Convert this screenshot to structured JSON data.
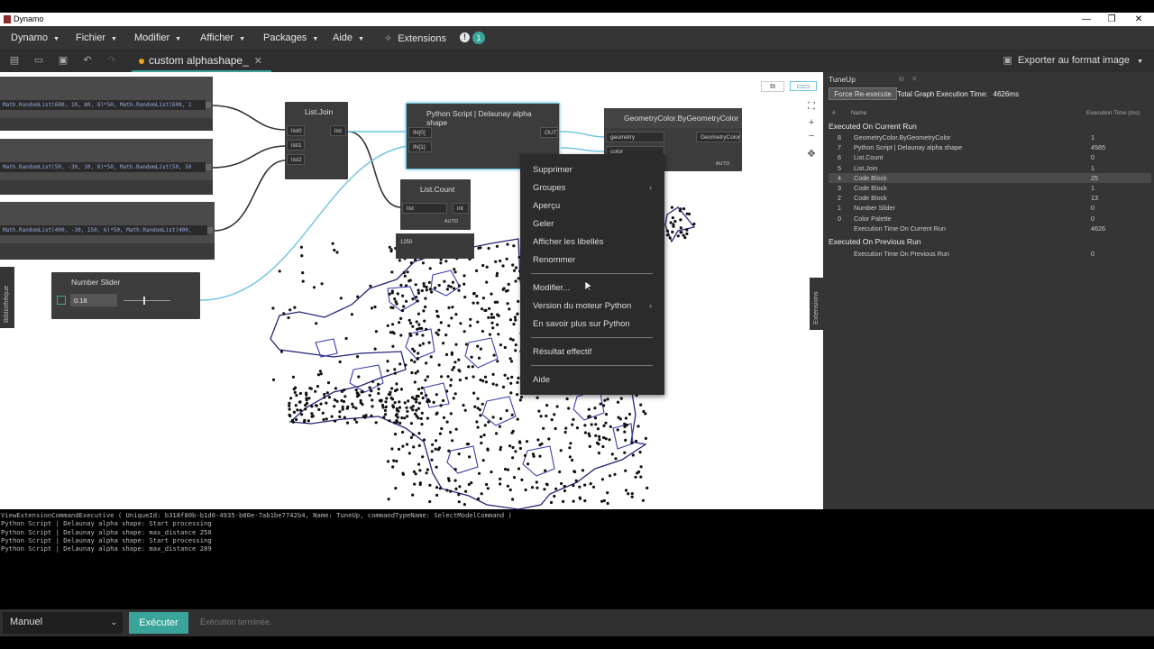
{
  "window": {
    "title": "Dynamo",
    "minimize": "—",
    "maximize": "❐",
    "close": "✕"
  },
  "menu": {
    "items": [
      "Dynamo",
      "Fichier",
      "Modifier",
      "Afficher",
      "Packages",
      "Aide"
    ],
    "extensions": "Extensions",
    "notification_count": "1",
    "alert": "!"
  },
  "toolbar": {
    "tab_title": "custom alphashape_",
    "tab_close": "✕",
    "export_label": "Exporter au format image"
  },
  "nodes": {
    "code_blocks": [
      "Math.RandomList(600, 10, 80, 8)*50, Math.RandomList(600, 1",
      "Math.RandomList(50, -30, 10, 8)*50, Math.RandomList(50, 50",
      "Math.RandomList(400, -30, 150, 6)*50, Math.RandomList(400,"
    ],
    "list_join": {
      "title": "List.Join",
      "inputs": [
        "list0",
        "list1",
        "list2"
      ],
      "output": "list"
    },
    "python": {
      "title": "Python Script | Delaunay alpha shape",
      "inputs": [
        "IN[0]",
        "IN[1]"
      ],
      "output": "OUT"
    },
    "list_count": {
      "title": "List.Count",
      "input": "list",
      "output": "int",
      "lacing": "AUTO",
      "watch": "1250"
    },
    "geometry_color": {
      "title": "GeometryColor.ByGeometryColor",
      "inputs": [
        "geometry",
        "color"
      ],
      "output": "GeometryColor",
      "lacing": "AUTO"
    },
    "number_slider": {
      "title": "Number Slider",
      "value": "0.18"
    }
  },
  "side_tabs": {
    "library": "Bibliothèque",
    "extensions": "Extensions"
  },
  "context_menu": {
    "items": [
      "Supprimer",
      "Groupes",
      "Aperçu",
      "Geler",
      "Afficher les libellés",
      "Renommer",
      "Modifier...",
      "Version du moteur Python",
      "En savoir plus sur Python",
      "Résultat effectif",
      "Aide"
    ]
  },
  "tuneup": {
    "title": "TuneUp",
    "force_button": "Force Re-execute",
    "total_label": "Total Graph Execution Time:",
    "total_value": "4626ms",
    "col_num": "#",
    "col_name": "Name",
    "col_time": "Execution Time (ms)",
    "section_current": "Executed On Current Run",
    "section_previous": "Executed On Previous Run",
    "rows_current": [
      {
        "num": "8",
        "name": "GeometryColor.ByGeometryColor",
        "time": "1"
      },
      {
        "num": "7",
        "name": "Python Script | Delaunay alpha shape",
        "time": "4585"
      },
      {
        "num": "6",
        "name": "List.Count",
        "time": "0"
      },
      {
        "num": "5",
        "name": "List.Join",
        "time": "1"
      },
      {
        "num": "4",
        "name": "Code Block",
        "time": "25"
      },
      {
        "num": "3",
        "name": "Code Block",
        "time": "1"
      },
      {
        "num": "2",
        "name": "Code Block",
        "time": "13"
      },
      {
        "num": "1",
        "name": "Number Slider",
        "time": "0"
      },
      {
        "num": "0",
        "name": "Color Palette",
        "time": "0"
      },
      {
        "num": "",
        "name": "Execution Time On Current Run",
        "time": "4626"
      }
    ],
    "rows_previous": [
      {
        "num": "",
        "name": "Execution Time On Previous Run",
        "time": "0"
      }
    ]
  },
  "console": [
    "ViewExtensionCommandExecutive ( UniqueId: b318f80b-b1d0-4935-b80e-7ab1be7742b4, Name: TuneUp, commandTypeName: SelectModelCommand )",
    "Python Script | Delaunay alpha shape: Start processing",
    "Python Script | Delaunay alpha shape: max_distance 250",
    "Python Script | Delaunay alpha shape: Start processing",
    "Python Script | Delaunay alpha shape: max_distance 289"
  ],
  "bottom": {
    "run_mode": "Manuel",
    "run_button": "Exécuter",
    "status": "Exécution terminée."
  },
  "colors": {
    "accent": "#3aa39a",
    "wire": "#6cc5e0",
    "outline": "#26257a"
  }
}
